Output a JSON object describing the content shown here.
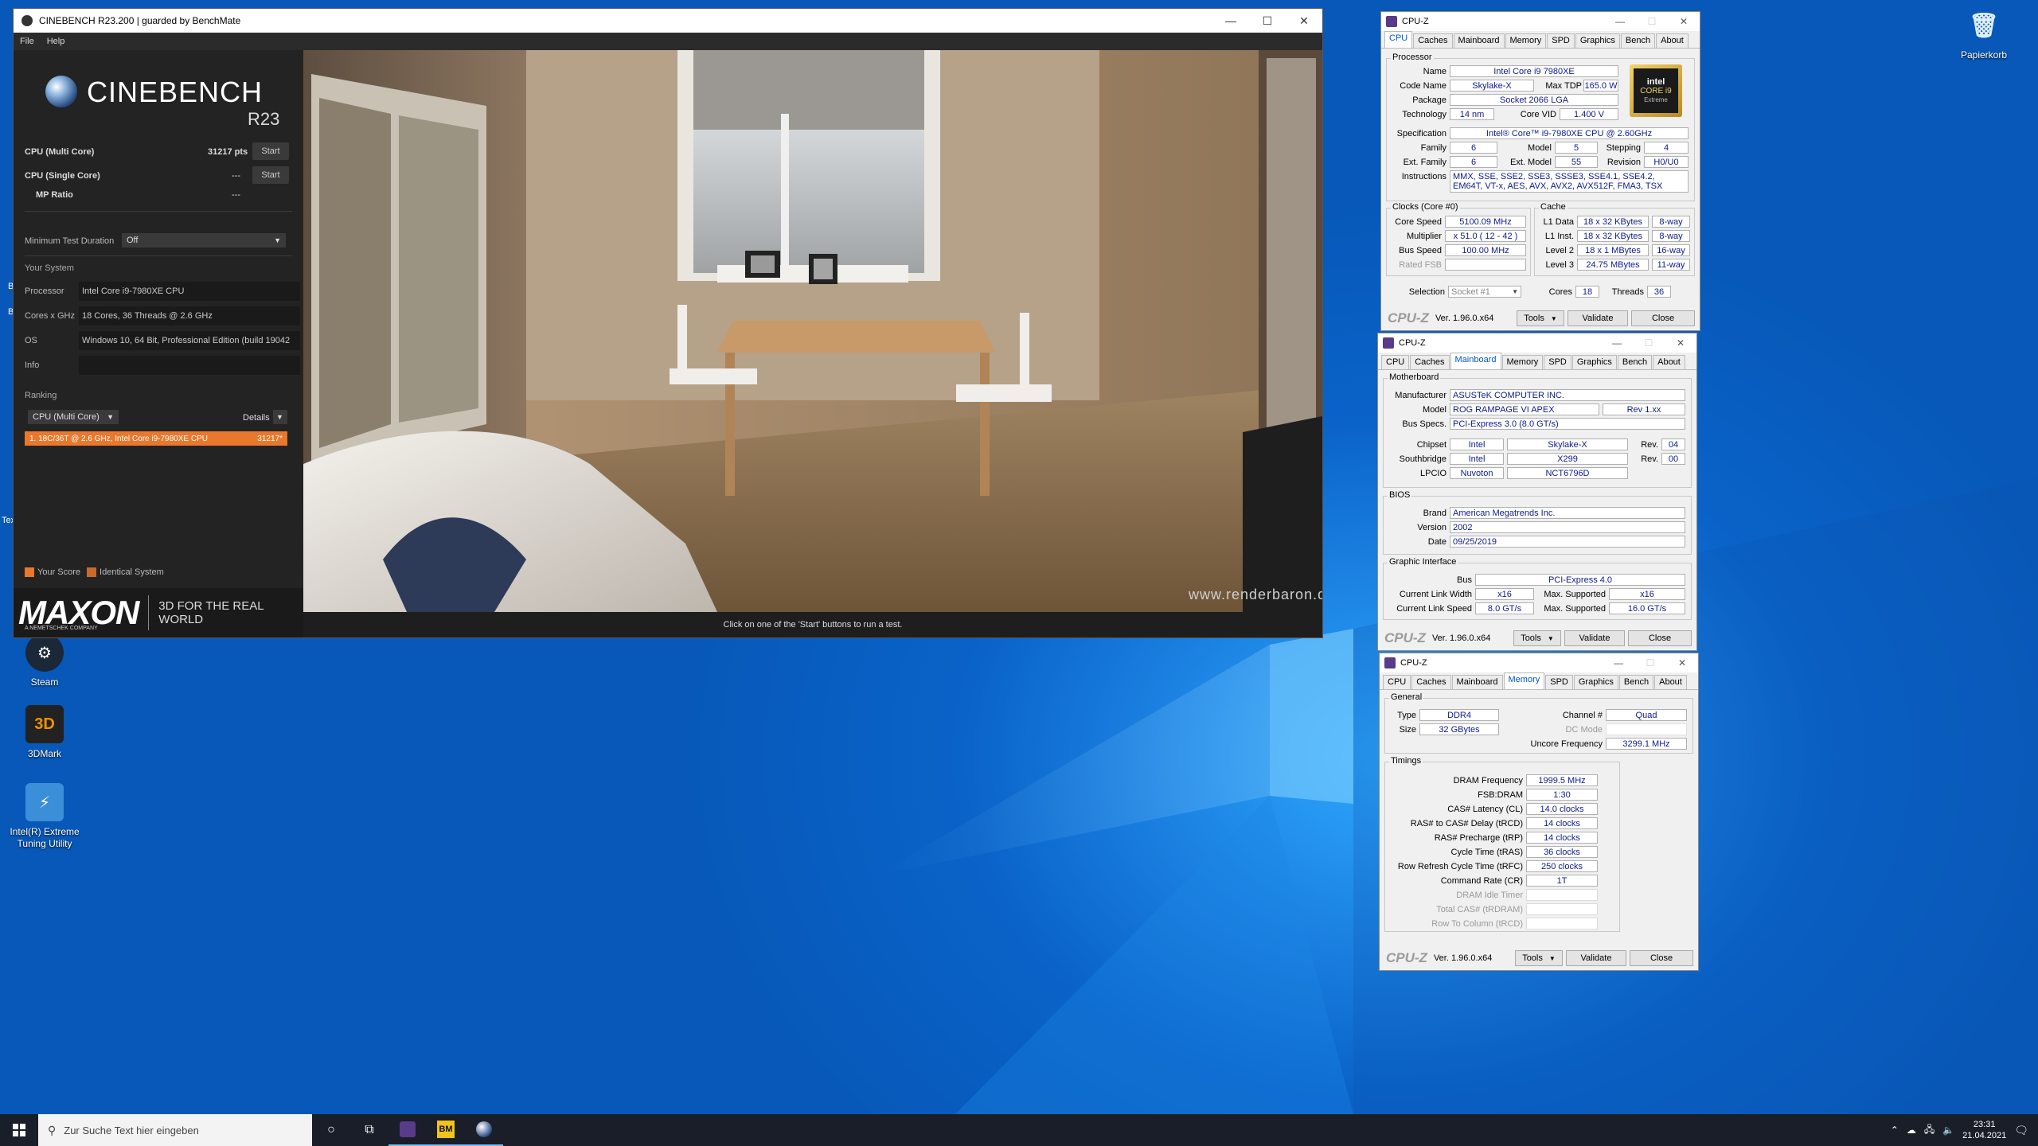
{
  "desktop": {
    "icons": [
      {
        "label": "Steam"
      },
      {
        "label": "3DMark"
      },
      {
        "label": "Intel(R) Extreme Tuning Utility"
      },
      {
        "label": "Papierkorb"
      }
    ],
    "clipped_texts": [
      "B",
      "B",
      "Tex"
    ]
  },
  "cinebench": {
    "title": "CINEBENCH R23.200 | guarded by BenchMate",
    "menu": [
      "File",
      "Help"
    ],
    "logo_name": "CINEBENCH",
    "logo_version": "R23",
    "tests": [
      {
        "label": "CPU (Multi Core)",
        "score": "31217 pts",
        "button": "Start"
      },
      {
        "label": "CPU (Single Core)",
        "score": "---",
        "button": "Start"
      },
      {
        "label": "MP Ratio",
        "score": "---"
      }
    ],
    "min_duration_label": "Minimum Test Duration",
    "min_duration_value": "Off",
    "your_system_label": "Your System",
    "system": [
      {
        "key": "Processor",
        "value": "Intel Core i9-7980XE CPU"
      },
      {
        "key": "Cores x GHz",
        "value": "18 Cores, 36 Threads @ 2.6 GHz"
      },
      {
        "key": "OS",
        "value": "Windows 10, 64 Bit, Professional Edition (build 19042"
      },
      {
        "key": "Info",
        "value": ""
      }
    ],
    "ranking_label": "Ranking",
    "ranking_select": "CPU (Multi Core)",
    "details_label": "Details",
    "ranking_entry": {
      "label": "1. 18C/36T @ 2.6 GHz, Intel Core i9-7980XE CPU",
      "score": "31217*"
    },
    "legend": {
      "your_score": "Your Score",
      "identical": "Identical System",
      "your_color": "#e9782d",
      "identical_color": "#c86a2a"
    },
    "maxon": "MAXON",
    "maxon_sub": "A NEMETSCHEK COMPANY",
    "tagline": "3D FOR THE REAL WORLD",
    "watermark": "www.renderbaron.de",
    "status": "Click on one of the 'Start' buttons to run a test."
  },
  "cpuz_common": {
    "tabs": [
      "CPU",
      "Caches",
      "Mainboard",
      "Memory",
      "SPD",
      "Graphics",
      "Bench",
      "About"
    ],
    "title": "CPU-Z",
    "brand": "CPU-Z",
    "version": "Ver. 1.96.0.x64",
    "tools": "Tools",
    "validate": "Validate",
    "close": "Close"
  },
  "cpuz_cpu": {
    "processor_group": "Processor",
    "name": "Intel Core i9 7980XE",
    "code_name": "Skylake-X",
    "max_tdp_label": "Max TDP",
    "max_tdp": "165.0 W",
    "package": "Socket 2066 LGA",
    "technology": "14 nm",
    "core_vid_label": "Core VID",
    "core_vid": "1.400 V",
    "specification": "Intel® Core™ i9-7980XE CPU @ 2.60GHz",
    "family": "6",
    "model": "5",
    "stepping": "4",
    "ext_family": "6",
    "ext_model": "55",
    "revision": "H0/U0",
    "instructions": "MMX, SSE, SSE2, SSE3, SSSE3, SSE4.1, SSE4.2, EM64T, VT-x, AES, AVX, AVX2, AVX512F, FMA3, TSX",
    "clocks_group": "Clocks (Core #0)",
    "core_speed": "5100.09 MHz",
    "multiplier": "x 51.0 ( 12 - 42 )",
    "bus_speed": "100.00 MHz",
    "rated_fsb_label": "Rated FSB",
    "cache_group": "Cache",
    "l1_data": "18 x 32 KBytes",
    "l1_data_way": "8-way",
    "l1_inst": "18 x 32 KBytes",
    "l1_inst_way": "8-way",
    "level2": "18 x 1 MBytes",
    "level2_way": "16-way",
    "level3": "24.75 MBytes",
    "level3_way": "11-way",
    "selection_label": "Selection",
    "selection": "Socket #1",
    "cores_label": "Cores",
    "cores": "18",
    "threads_label": "Threads",
    "threads": "36",
    "labels": {
      "name": "Name",
      "code_name": "Code Name",
      "package": "Package",
      "technology": "Technology",
      "specification": "Specification",
      "family": "Family",
      "model": "Model",
      "stepping": "Stepping",
      "ext_family": "Ext. Family",
      "ext_model": "Ext. Model",
      "revision": "Revision",
      "instructions": "Instructions",
      "core_speed": "Core Speed",
      "multiplier": "Multiplier",
      "bus_speed": "Bus Speed",
      "l1_data": "L1 Data",
      "l1_inst": "L1 Inst.",
      "level2": "Level 2",
      "level3": "Level 3"
    },
    "intel_logo": {
      "brand": "intel",
      "line1": "CORE i9",
      "line2": "Extreme"
    }
  },
  "cpuz_mainboard": {
    "motherboard_group": "Motherboard",
    "manufacturer": "ASUSTeK COMPUTER INC.",
    "model": "ROG RAMPAGE VI APEX",
    "model_rev": "Rev 1.xx",
    "bus_specs": "PCI-Express 3.0 (8.0 GT/s)",
    "chipset": "Intel",
    "chipset_name": "Skylake-X",
    "chipset_rev": "04",
    "southbridge": "Intel",
    "southbridge_name": "X299",
    "southbridge_rev": "00",
    "lpcio": "Nuvoton",
    "lpcio_name": "NCT6796D",
    "bios_group": "BIOS",
    "bios_brand": "American Megatrends Inc.",
    "bios_version": "2002",
    "bios_date": "09/25/2019",
    "graphic_group": "Graphic Interface",
    "gi_bus": "PCI-Express 4.0",
    "link_width": "x16",
    "max_link_width": "x16",
    "link_speed": "8.0 GT/s",
    "max_link_speed": "16.0 GT/s",
    "labels": {
      "manufacturer": "Manufacturer",
      "model": "Model",
      "bus_specs": "Bus Specs.",
      "chipset": "Chipset",
      "southbridge": "Southbridge",
      "lpcio": "LPCIO",
      "rev": "Rev.",
      "brand": "Brand",
      "version": "Version",
      "date": "Date",
      "bus": "Bus",
      "link_width": "Current Link Width",
      "link_speed": "Current Link Speed",
      "max_supported": "Max. Supported"
    }
  },
  "cpuz_memory": {
    "general_group": "General",
    "type": "DDR4",
    "size": "32 GBytes",
    "channel": "Quad",
    "dc_mode_label": "DC Mode",
    "uncore_freq": "3299.1 MHz",
    "timings_group": "Timings",
    "timings": [
      {
        "label": "DRAM Frequency",
        "value": "1999.5 MHz"
      },
      {
        "label": "FSB:DRAM",
        "value": "1:30"
      },
      {
        "label": "CAS# Latency (CL)",
        "value": "14.0 clocks"
      },
      {
        "label": "RAS# to CAS# Delay (tRCD)",
        "value": "14 clocks"
      },
      {
        "label": "RAS# Precharge (tRP)",
        "value": "14 clocks"
      },
      {
        "label": "Cycle Time (tRAS)",
        "value": "36 clocks"
      },
      {
        "label": "Row Refresh Cycle Time (tRFC)",
        "value": "250 clocks"
      },
      {
        "label": "Command Rate (CR)",
        "value": "1T"
      },
      {
        "label": "DRAM Idle Timer",
        "value": ""
      },
      {
        "label": "Total CAS# (tRDRAM)",
        "value": ""
      },
      {
        "label": "Row To Column (tRCD)",
        "value": ""
      }
    ],
    "labels": {
      "type": "Type",
      "size": "Size",
      "channel": "Channel #",
      "uncore": "Uncore Frequency"
    }
  },
  "taskbar": {
    "search_placeholder": "Zur Suche Text hier eingeben",
    "bm_label": "BM",
    "time": "23:31",
    "date": "21.04.2021"
  }
}
